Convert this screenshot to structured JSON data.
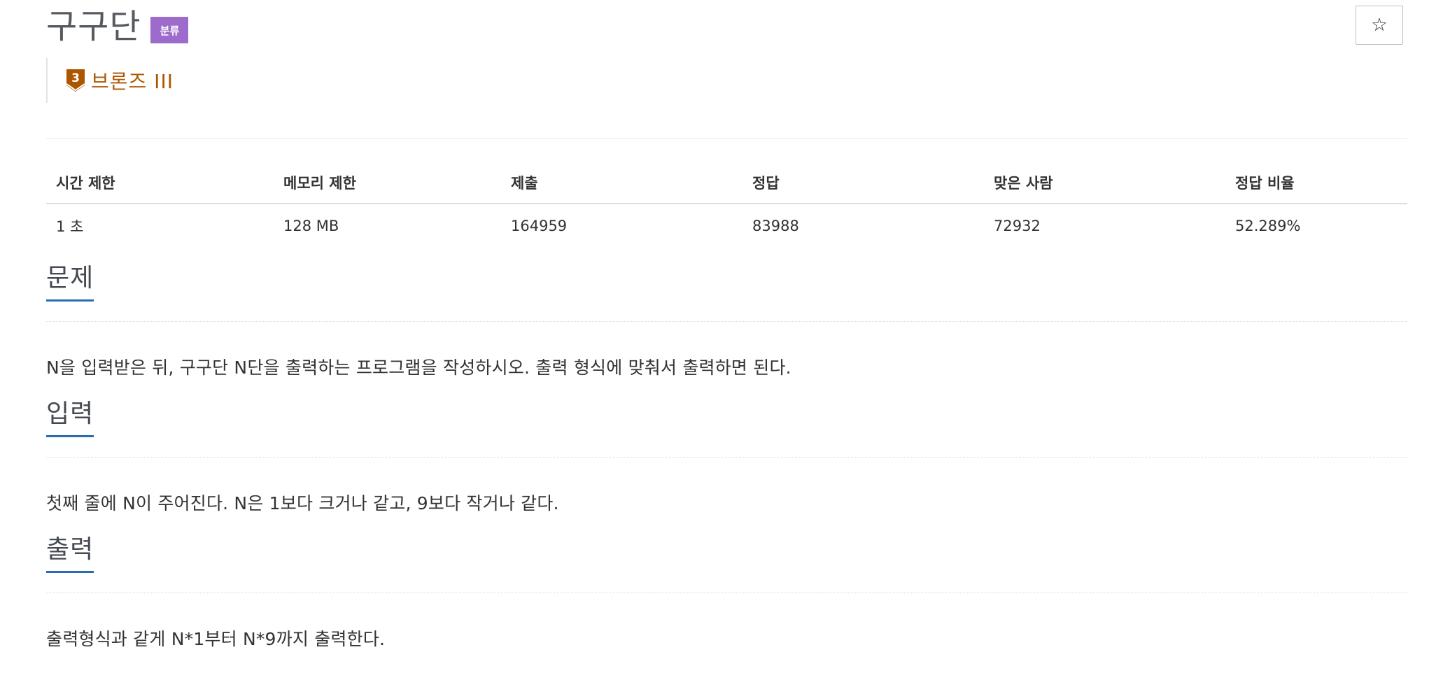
{
  "problem": {
    "title": "구구단",
    "category_badge": "분류",
    "star_icon": "☆",
    "tier": {
      "number": "3",
      "label": "브론즈 III",
      "color": "#ad5600"
    }
  },
  "stats": {
    "headers": [
      "시간 제한",
      "메모리 제한",
      "제출",
      "정답",
      "맞은 사람",
      "정답 비율"
    ],
    "values": [
      "1 초",
      "128 MB",
      "164959",
      "83988",
      "72932",
      "52.289%"
    ]
  },
  "sections": {
    "description": {
      "title": "문제",
      "body": "N을 입력받은 뒤, 구구단 N단을 출력하는 프로그램을 작성하시오. 출력 형식에 맞춰서 출력하면 된다."
    },
    "input": {
      "title": "입력",
      "body": "첫째 줄에 N이 주어진다. N은 1보다 크거나 같고, 9보다 작거나 같다."
    },
    "output": {
      "title": "출력",
      "body": "출력형식과 같게 N*1부터 N*9까지 출력한다."
    }
  },
  "colors": {
    "badge": "#9c6bcb",
    "section_underline": "#2b6cb0",
    "tier": "#ad5600"
  }
}
